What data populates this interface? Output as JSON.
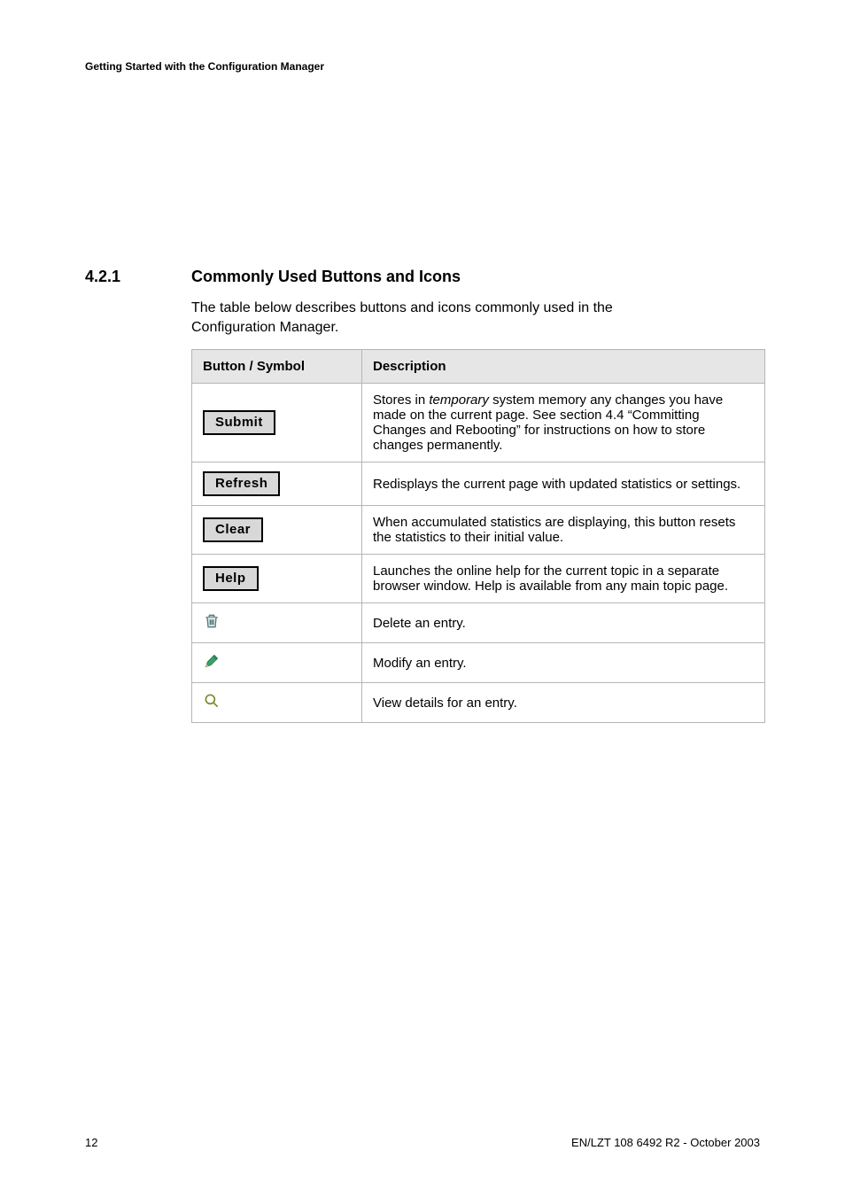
{
  "header": {
    "running": "Getting Started with the Configuration Manager"
  },
  "section": {
    "number": "4.2.1",
    "title": "Commonly Used Buttons and Icons",
    "intro": "The table below describes buttons and icons commonly used in the Configuration Manager."
  },
  "table": {
    "headers": {
      "symbol": "Button / Symbol",
      "description": "Description"
    },
    "rows": [
      {
        "kind": "button",
        "label": "Submit",
        "description_pre": "Stores in ",
        "description_ital": "temporary",
        "description_post": " system memory any changes you have made on the current page. See section 4.4 “Committing Changes and Rebooting” for instructions on how to store changes permanently."
      },
      {
        "kind": "button",
        "label": "Refresh",
        "description": "Redisplays the current page with updated statistics or settings."
      },
      {
        "kind": "button",
        "label": "Clear",
        "description": "When accumulated statistics are displaying, this button resets the statistics to their initial value."
      },
      {
        "kind": "button",
        "label": "Help",
        "description": "Launches the online help for the current topic in a separate browser window. Help is available from any main topic page."
      },
      {
        "kind": "icon",
        "icon_name": "trash-icon",
        "description": "Delete an entry."
      },
      {
        "kind": "icon",
        "icon_name": "pencil-icon",
        "description": "Modify an entry."
      },
      {
        "kind": "icon",
        "icon_name": "magnifier-icon",
        "description": "View details for an entry."
      }
    ]
  },
  "footer": {
    "page_number": "12",
    "doc_id": "EN/LZT 108 6492 R2  - October 2003"
  }
}
